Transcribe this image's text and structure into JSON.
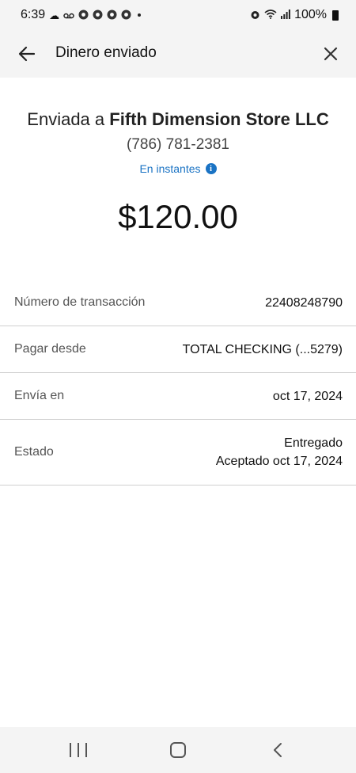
{
  "status_bar": {
    "time": "6:39",
    "battery_text": "100%",
    "icons_left": [
      "cloud-icon",
      "voicemail-icon",
      "chrome-icon",
      "chrome-icon",
      "chrome-icon",
      "chrome-icon"
    ],
    "icons_right": [
      "alarm-icon",
      "wifi-icon",
      "signal-icon",
      "battery-icon"
    ]
  },
  "app_bar": {
    "title": "Dinero enviado"
  },
  "header": {
    "sent_to_prefix": "Enviada a",
    "recipient_name": "Fifth Dimension Store LLC",
    "phone": "(786) 781-2381",
    "speed_label": "En instantes",
    "amount": "$120.00"
  },
  "details": {
    "transaction": {
      "label": "Número de transacción",
      "value": "22408248790"
    },
    "pay_from": {
      "label": "Pagar desde",
      "value": "TOTAL CHECKING (...5279)"
    },
    "send_on": {
      "label": "Envía en",
      "value": "oct 17, 2024"
    },
    "status": {
      "label": "Estado",
      "value_line1": "Entregado",
      "value_line2": "Aceptado oct 17, 2024"
    }
  },
  "colors": {
    "accent": "#1a73c4",
    "bar_background": "#f4f4f4",
    "divider": "#cfcfcf"
  }
}
